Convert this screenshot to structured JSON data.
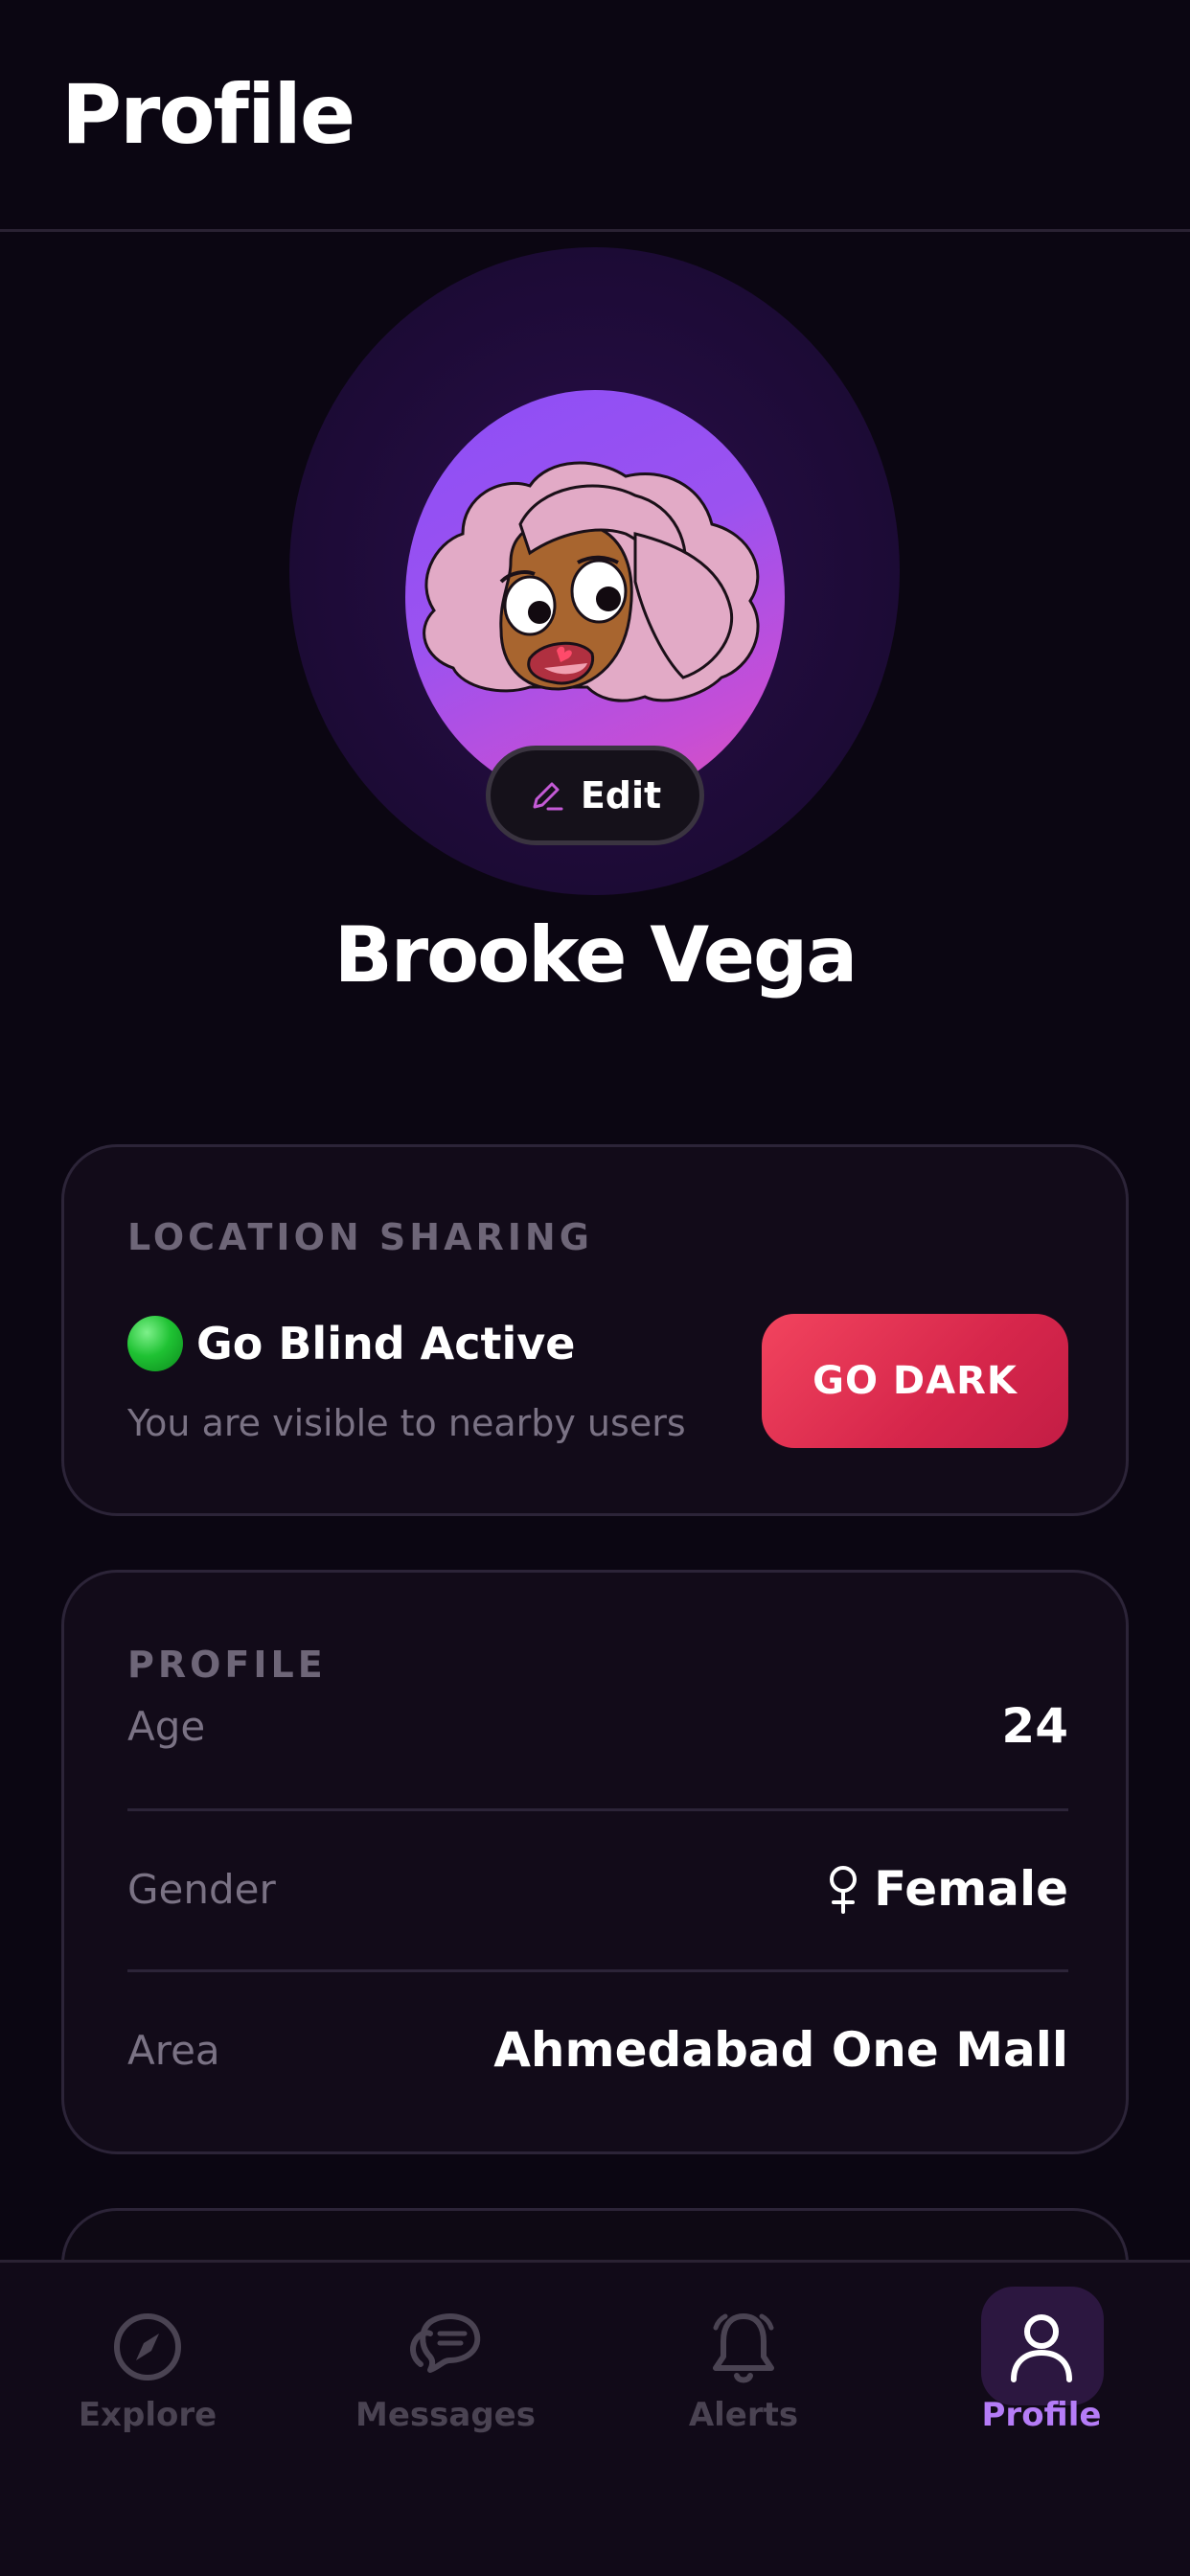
{
  "header": {
    "title": "Profile"
  },
  "avatar": {
    "edit_label": "Edit"
  },
  "user": {
    "name": "Brooke Vega"
  },
  "location_sharing": {
    "section_label": "LOCATION SHARING",
    "status_title": "Go Blind Active",
    "status_subtitle": "You are visible to nearby users",
    "button_label": "GO DARK"
  },
  "profile": {
    "section_label": "PROFILE",
    "rows": [
      {
        "label": "Age",
        "value": "24"
      },
      {
        "label": "Gender",
        "value": "Female",
        "icon": "female-icon"
      },
      {
        "label": "Area",
        "value": "Ahmedabad One Mall"
      }
    ]
  },
  "nav": {
    "items": [
      {
        "label": "Explore",
        "icon": "compass-icon",
        "active": false
      },
      {
        "label": "Messages",
        "icon": "chat-bubbles-icon",
        "active": false
      },
      {
        "label": "Alerts",
        "icon": "bell-icon",
        "active": false
      },
      {
        "label": "Profile",
        "icon": "user-icon",
        "active": true
      }
    ]
  },
  "colors": {
    "background": "#0b0612",
    "card": "#120b19",
    "accent_purple": "#b57cf7",
    "go_dark_red": "#e0345a",
    "status_green": "#1fc233"
  }
}
